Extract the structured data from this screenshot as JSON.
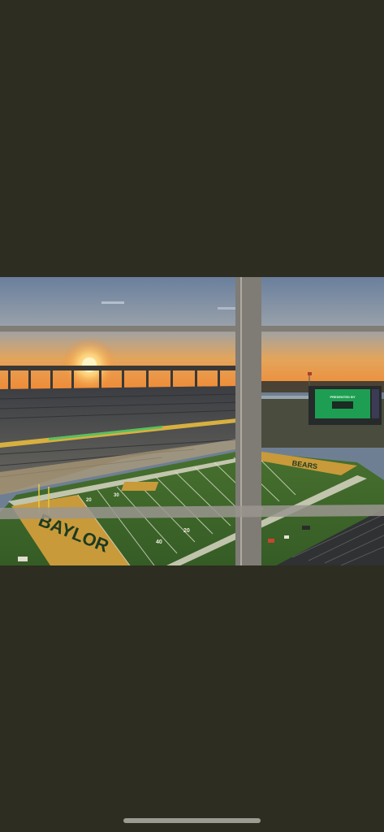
{
  "viewer": {
    "background_color": "#2d2d21",
    "home_indicator_color": "#9c9c92"
  },
  "photo": {
    "description_icon": "stadium-sunset-photo",
    "endzone_left_text": "BAYLOR",
    "endzone_right_text": "BEARS",
    "scoreboard_text": "PRESENTED BY",
    "field_numbers": [
      "20",
      "30",
      "40",
      "20"
    ],
    "colors": {
      "sky_top": "#6f86a6",
      "sky_horizon": "#f2a24a",
      "sun": "#fff1b0",
      "field_green": "#3f6a2c",
      "endzone_gold": "#c99a3a",
      "endzone_green": "#1c3b22",
      "window_frame": "#8a8782"
    }
  }
}
